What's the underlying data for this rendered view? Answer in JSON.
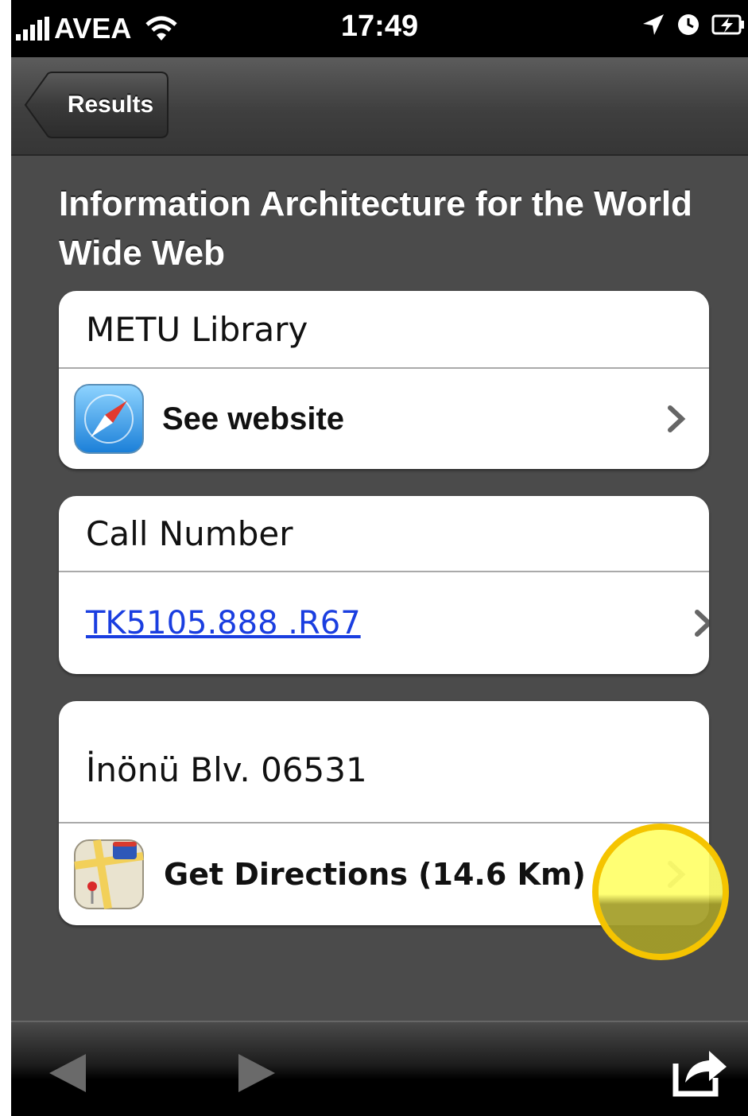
{
  "status_bar": {
    "carrier": "AVEA",
    "time": "17:49",
    "icons": [
      "signal-icon",
      "wifi-icon",
      "location-arrow-icon",
      "clock-icon",
      "battery-charging-icon"
    ]
  },
  "nav_bar": {
    "back_label": "Results"
  },
  "title": "Information Architecture for the World Wide Web",
  "library_card": {
    "library_name": "METU Library",
    "website_label": "See website",
    "website_icon": "safari-compass-icon"
  },
  "call_number_card": {
    "header": "Call Number",
    "call_number": "TK5105.888 .R67"
  },
  "address_card": {
    "address": "İnönü Blv. 06531",
    "directions_label": "Get Directions (14.6 Km)",
    "directions_icon": "maps-icon"
  },
  "toolbar": {
    "icons": [
      "back-arrow-icon",
      "forward-arrow-icon",
      "share-icon"
    ]
  },
  "colors": {
    "background": "#4b4b4b",
    "link": "#1a3ee0",
    "highlight_ring": "#f5c400",
    "highlight_fill": "#ffff46"
  }
}
